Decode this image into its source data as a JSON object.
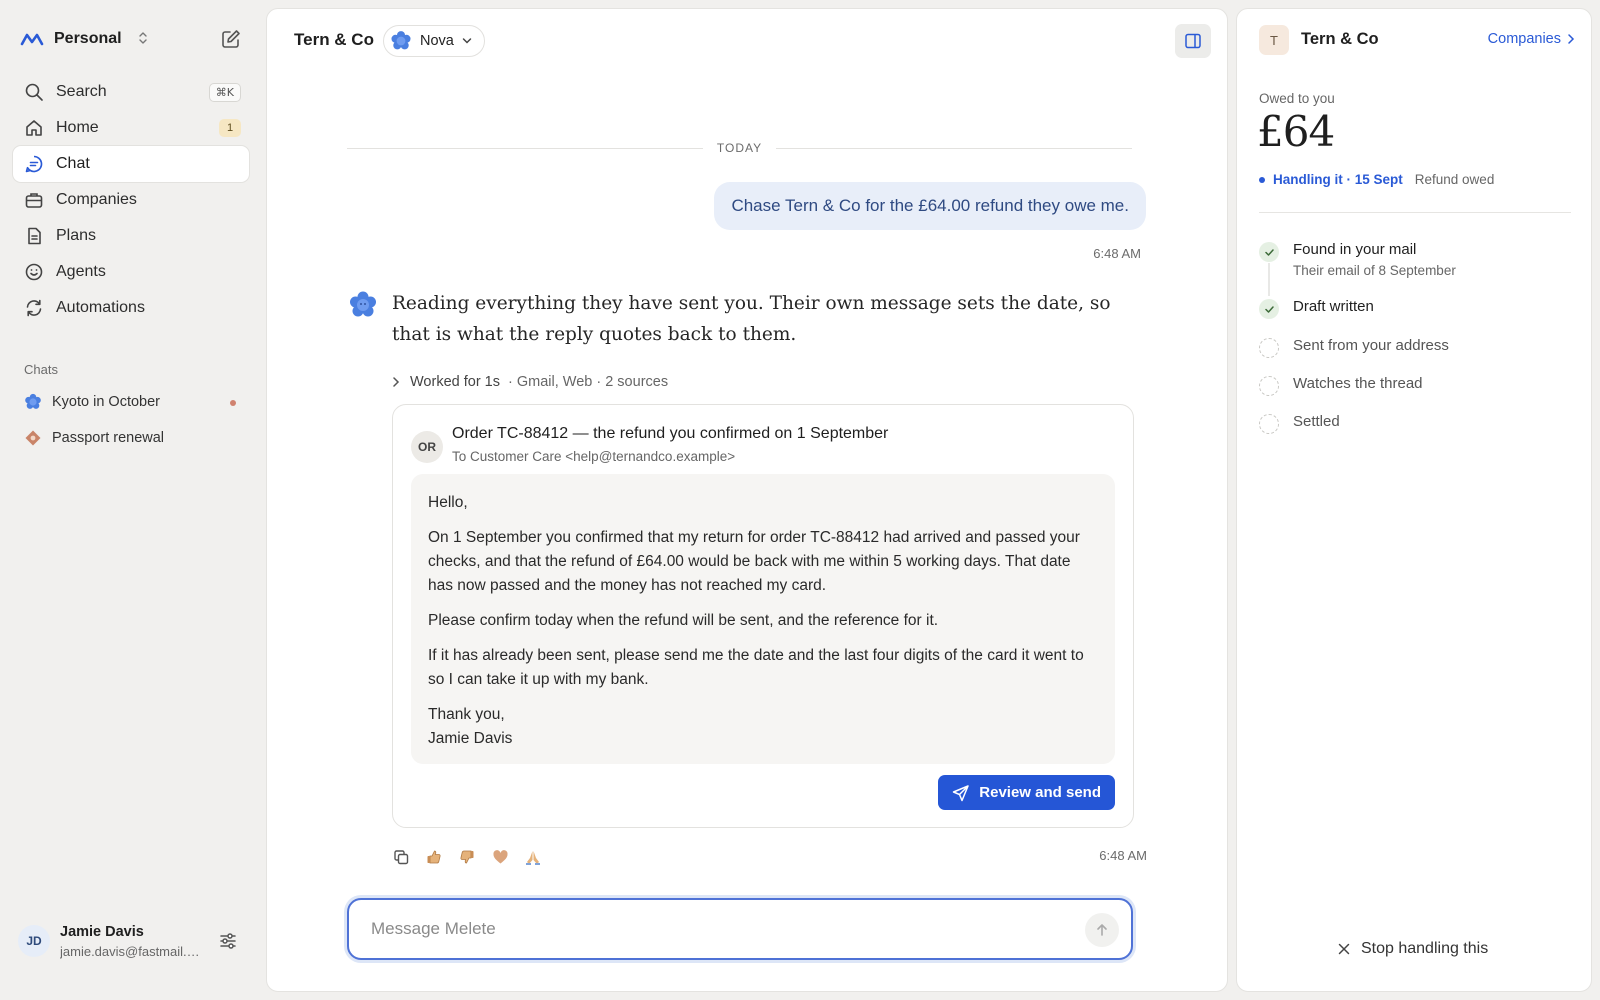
{
  "workspace": {
    "name": "Personal"
  },
  "nav": [
    {
      "label": "Search",
      "icon": "search-icon",
      "shortcut": "⌘K"
    },
    {
      "label": "Home",
      "icon": "home-icon",
      "badge": "1"
    },
    {
      "label": "Chat",
      "icon": "chat-icon",
      "active": true
    },
    {
      "label": "Companies",
      "icon": "briefcase-icon"
    },
    {
      "label": "Plans",
      "icon": "document-icon"
    },
    {
      "label": "Agents",
      "icon": "smile-icon"
    },
    {
      "label": "Automations",
      "icon": "refresh-icon"
    }
  ],
  "chats_section": {
    "label": "Chats"
  },
  "chats": [
    {
      "label": "Kyoto in October",
      "icon": "nova-icon",
      "unread": true
    },
    {
      "label": "Passport renewal",
      "icon": "passport-icon"
    }
  ],
  "user": {
    "initials": "JD",
    "name": "Jamie Davis",
    "email": "jamie.davis@fastmail.com"
  },
  "main": {
    "title": "Tern & Co",
    "agent": "Nova",
    "day_label": "TODAY",
    "user_message": "Chase Tern & Co for the £64.00 refund they owe me.",
    "user_time": "6:48 AM",
    "bot_message": "Reading everything they have sent you. Their own message sets the date, so that is what the reply quotes back to them.",
    "worked": {
      "label": "Worked for 1s",
      "meta": "· Gmail, Web · 2 sources"
    },
    "email": {
      "avatar": "OR",
      "subject": "Order TC-88412 — the refund you confirmed on 1 September",
      "to": "To Customer Care <help@ternandco.example>",
      "greeting": "Hello,",
      "para1": "On 1 September you confirmed that my return for order TC-88412 had arrived and passed your checks, and that the refund of £64.00 would be back with me within 5 working days. That date has now passed and the money has not reached my card.",
      "para2": "Please confirm today when the refund will be sent, and the reference for it.",
      "para3": "If it has already been sent, please send me the date and the last four digits of the card it went to so I can take it up with my bank.",
      "signoff": "Thank you,",
      "signature": "Jamie Davis",
      "send_label": "Review and send"
    },
    "bot_time": "6:48 AM",
    "composer_placeholder": "Message Melete"
  },
  "panel": {
    "avatar": "T",
    "company": "Tern & Co",
    "link": "Companies",
    "owed_label": "Owed to you",
    "owed_amount": "£64",
    "status": "Handling it · 15 Sept",
    "status_sub": "Refund owed",
    "steps": [
      {
        "title": "Found in your mail",
        "sub": "Their email of 8 September",
        "done": true
      },
      {
        "title": "Draft written",
        "done": true
      },
      {
        "title": "Sent from your address",
        "done": false
      },
      {
        "title": "Watches the thread",
        "done": false
      },
      {
        "title": "Settled",
        "done": false
      }
    ],
    "stop_label": "Stop handling this"
  },
  "colors": {
    "accent": "#2556d6",
    "bubble": "#e8eef9",
    "background": "#f1f0ee"
  }
}
